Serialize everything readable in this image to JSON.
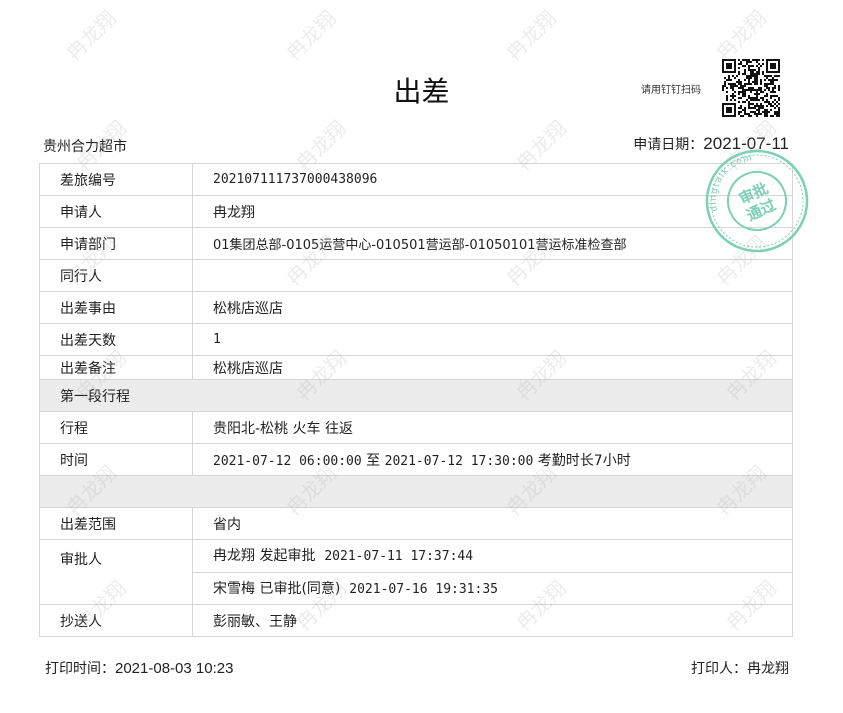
{
  "header": {
    "title": "出差",
    "qr_caption": "请用钉钉扫码",
    "company": "贵州合力超市",
    "apply_date_label": "申请日期：",
    "apply_date_value": "2021-07-11"
  },
  "rows": [
    {
      "label": "差旅编号",
      "value": "20210711173700043809​6"
    },
    {
      "label": "申请人",
      "value": "冉龙翔"
    },
    {
      "label": "申请部门",
      "value": "01集团总部-0105运营中心-010501营运部-01050101营运标准检查部"
    },
    {
      "label": "同行人",
      "value": ""
    },
    {
      "label": "出差事由",
      "value": "松桃店巡店"
    },
    {
      "label": "出差天数",
      "value": "1"
    },
    {
      "label": "出差备注",
      "value": "松桃店巡店"
    }
  ],
  "segment": {
    "title": "第一段行程",
    "route_label": "行程",
    "route_value": "贵阳北-松桃 火车 往返",
    "time_label": "时间",
    "time_start": "2021-07-12 06:00:00",
    "time_to": "至",
    "time_end": "2021-07-12 17:30:00",
    "time_note": "考勤时长7小时"
  },
  "scope": {
    "label": "出差范围",
    "value": "省内"
  },
  "approval": {
    "label": "审批人",
    "entries": [
      {
        "name_action": "冉龙翔 发起审批",
        "time": "2021-07-11 17:37:44"
      },
      {
        "name_action": "宋雪梅 已审批(同意)",
        "time": "2021-07-16 19:31:35"
      }
    ]
  },
  "cc": {
    "label": "抄送人",
    "value": "彭丽敏、王静"
  },
  "footer": {
    "print_time_label": "打印时间：",
    "print_time_value": "2021-08-03 10:23",
    "printer_label": "打印人：",
    "printer_value": "冉龙翔"
  },
  "stamp": {
    "line1": "审批",
    "line2": "通过",
    "ring_text": "dingtalk.com",
    "color": "#7dcfb6"
  },
  "watermark": {
    "text": "冉龙翔",
    "color": "#bbbbbb"
  }
}
